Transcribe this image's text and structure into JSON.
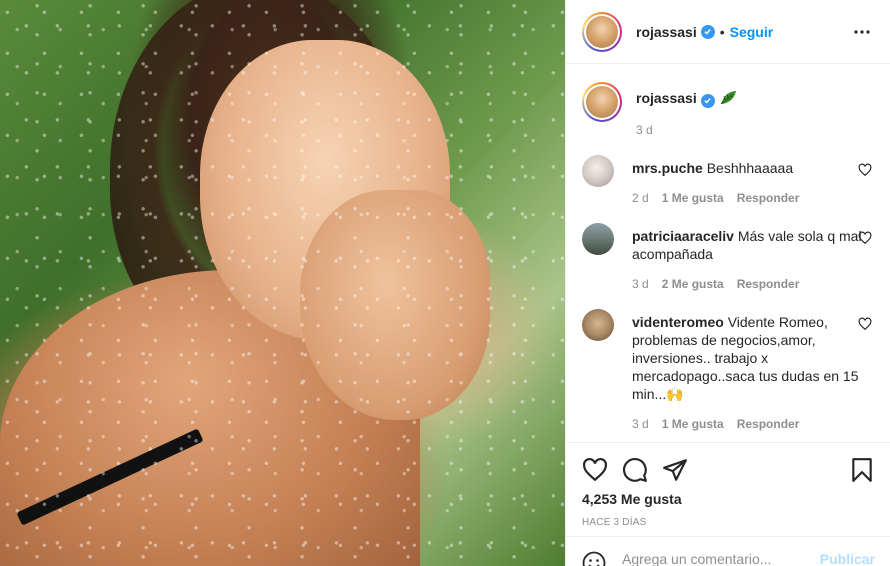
{
  "post": {
    "author": "rojassasi",
    "follow_label": "Seguir",
    "dot": "•",
    "caption": {
      "username": "rojassasi",
      "emoji": "leaf-emoji",
      "time": "3 d"
    },
    "comments": [
      {
        "username": "mrs.puche",
        "text": "Beshhhaaaaa",
        "time": "2 d",
        "likes": "1 Me gusta",
        "reply": "Responder",
        "avatar_color": "#cfc5c0"
      },
      {
        "username": "patriciaaraceliv",
        "text": "Más vale sola q mal acompañada",
        "time": "3 d",
        "likes": "2 Me gusta",
        "reply": "Responder",
        "avatar_color": "#6f7f7a"
      },
      {
        "username": "videnteromeo",
        "text": "Vidente Romeo, problemas de negocios,amor, inversiones.. trabajo x mercadopago..saca tus dudas en 15 min...🙌",
        "time": "3 d",
        "likes": "1 Me gusta",
        "reply": "Responder",
        "avatar_color": "#a88a66"
      }
    ],
    "like_count": "4,253 Me gusta",
    "posted_ago": "HACE 3 DÍAS",
    "comment_placeholder": "Agrega un comentario...",
    "publish_label": "Publicar"
  },
  "colors": {
    "accent": "#0095f6",
    "verified": "#3897f0",
    "muted": "#8e8e8e",
    "publish_disabled": "#b2dffc"
  }
}
